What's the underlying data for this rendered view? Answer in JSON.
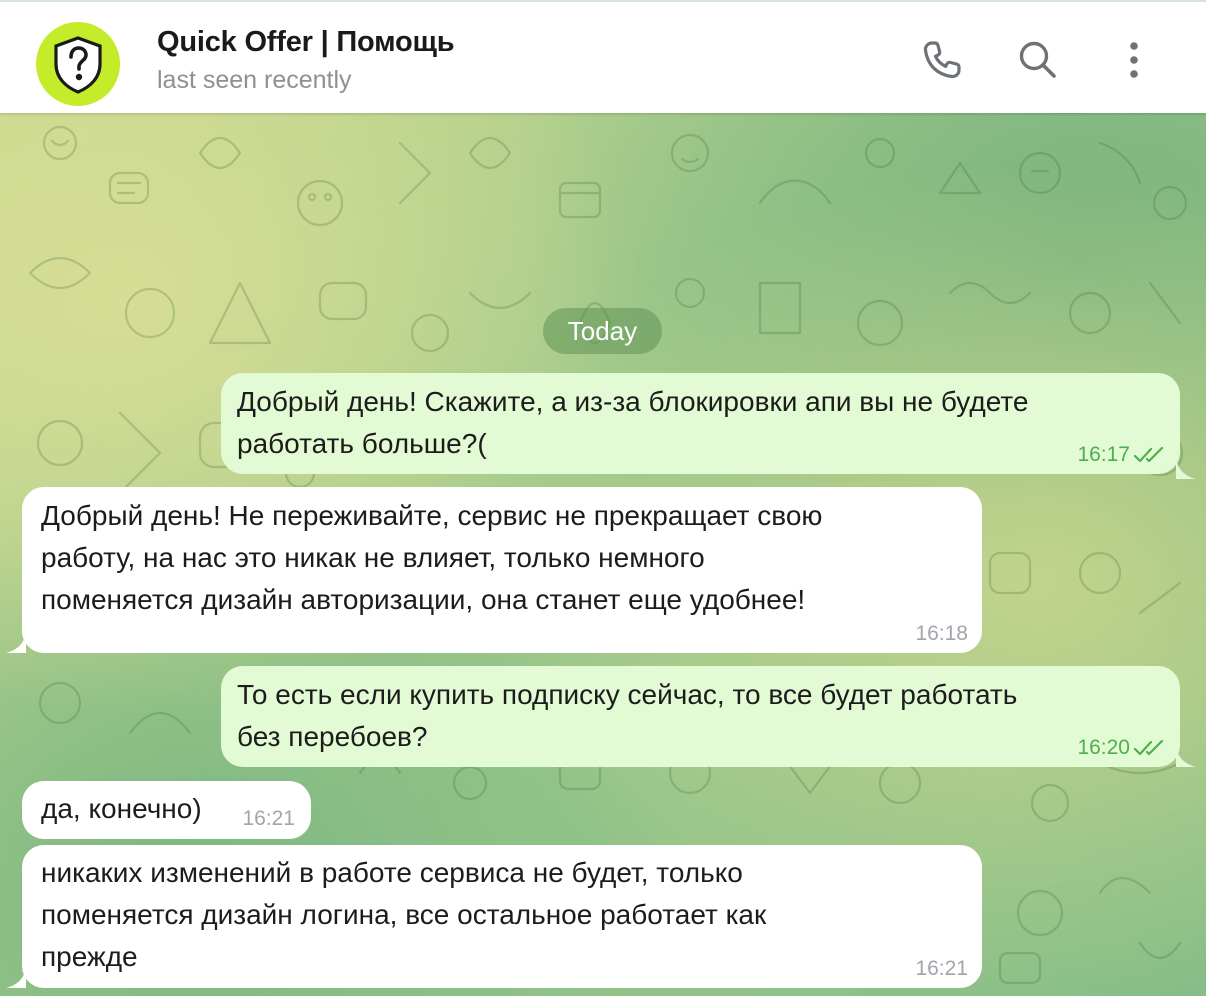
{
  "header": {
    "title": "Quick Offer | Помощь",
    "status": "last seen recently",
    "avatar_color": "#c5ec2a",
    "buttons": [
      "phone-icon",
      "search-icon",
      "more-vert-icon"
    ]
  },
  "date_separator": "Today",
  "messages": [
    {
      "direction": "outgoing",
      "text": "Добрый день! Скажите, а из-за блокировки апи вы не будете\nработать больше?(",
      "time": "16:17",
      "read": true
    },
    {
      "direction": "incoming",
      "text": "Добрый день! Не переживайте, сервис не прекращает свою\nработу, на нас это никак не влияет, только немного\nпоменяется дизайн авторизации, она станет еще удобнее!",
      "time": "16:18"
    },
    {
      "direction": "outgoing",
      "text": "То есть если купить подписку сейчас, то все будет работать\nбез перебоев?",
      "time": "16:20",
      "read": true
    },
    {
      "direction": "incoming",
      "text": "да, конечно)",
      "time": "16:21"
    },
    {
      "direction": "incoming",
      "text": "никаких изменений в работе сервиса не будет, только\nпоменяется дизайн логина, все остальное работает как\nпрежде",
      "time": "16:21"
    }
  ],
  "colors": {
    "outgoing_bubble": "#e2fbd4",
    "incoming_bubble": "#ffffff",
    "check_marks": "#4fae4e"
  }
}
